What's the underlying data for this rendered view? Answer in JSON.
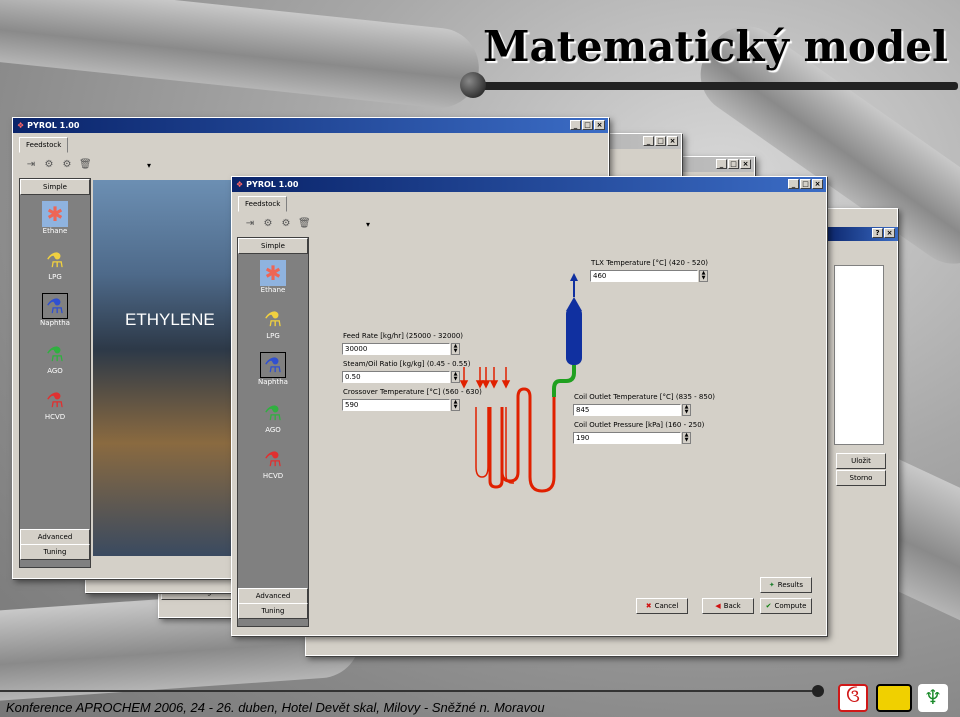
{
  "slide": {
    "title": "Matematický model",
    "footer": "Konference APROCHEM 2006, 24 - 26. duben, Hotel Devět skal, Milovy - Sněžné n. Moravou"
  },
  "colors": {
    "titlebar": "#0a246a",
    "window": "#d4d0c8",
    "coil": "#e02000",
    "tlx": "#1030a0",
    "pipe_green": "#20a020",
    "logo_red": "#d01818",
    "logo_yellow": "#f0d000",
    "logo_green": "#1a8a2a"
  },
  "app": {
    "title": "PYROL 1.00",
    "window_buttons": [
      "_",
      "□",
      "×"
    ],
    "tab": "Feedstock",
    "dropdown_arrow": "▾"
  },
  "toolbar": {
    "icons": [
      "open-icon",
      "copy-icon",
      "paste-icon",
      "delete-icon"
    ]
  },
  "sidebar": {
    "simple": "Simple",
    "advanced": "Advanced",
    "tuning": "Tuning",
    "feedstocks": [
      {
        "label": "Ethane",
        "icon": "ethane-molecule-icon"
      },
      {
        "label": "LPG",
        "icon": "flask-yellow-icon"
      },
      {
        "label": "Naphtha",
        "icon": "flask-blue-icon",
        "badge": "PN"
      },
      {
        "label": "AGO",
        "icon": "flask-green-icon",
        "badge": "AGO"
      },
      {
        "label": "HCVD",
        "icon": "flask-red-icon",
        "badge": "HCVD"
      }
    ]
  },
  "back_window": {
    "banner": "ETHYLENE"
  },
  "form": {
    "tlx_label": "TLX Temperature [°C] (420 - 520)",
    "tlx_value": "460",
    "feed_label": "Feed Rate [kg/hr] (25000 - 32000)",
    "feed_value": "30000",
    "steam_label": "Steam/Oil Ratio [kg/kg] (0.45 - 0.55)",
    "steam_value": "0.50",
    "cross_label": "Crossover Temperature [°C] (560 - 630)",
    "cross_value": "590",
    "cot_label": "Coil Outlet Temperature [°C] (835 - 850)",
    "cot_value": "845",
    "cop_label": "Coil Outlet Pressure [kPa] (160 - 250)",
    "cop_value": "190"
  },
  "buttons": {
    "results": "Results",
    "cancel": "Cancel",
    "back": "Back",
    "compute": "Compute",
    "save": "Uložit",
    "storno": "Storno"
  },
  "right_dialog": {
    "help": "?",
    "close": "×"
  }
}
